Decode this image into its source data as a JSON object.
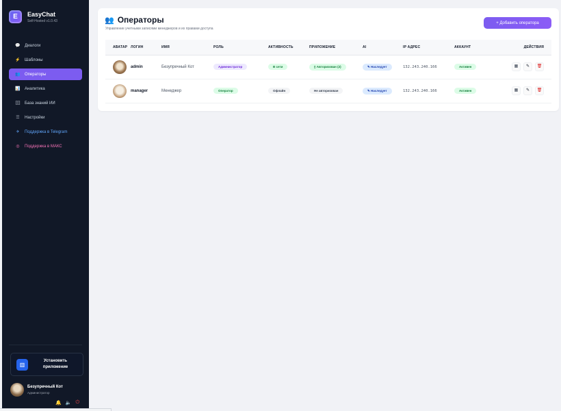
{
  "brand": {
    "logo_letter": "E",
    "name": "EasyChat",
    "version": "Self-Hosted v1.0.43"
  },
  "nav": [
    {
      "label": "Диалоги",
      "icon": "chat-icon",
      "glyph": "💬",
      "active": false
    },
    {
      "label": "Шаблоны",
      "icon": "bolt-icon",
      "glyph": "⚡",
      "active": false
    },
    {
      "label": "Операторы",
      "icon": "users-icon",
      "glyph": "👥",
      "active": true
    },
    {
      "label": "Аналитика",
      "icon": "chart-icon",
      "glyph": "📊",
      "active": false
    },
    {
      "label": "База знаний ИИ",
      "icon": "database-icon",
      "glyph": "🗄",
      "active": false
    },
    {
      "label": "Настройки",
      "icon": "sliders-icon",
      "glyph": "☰",
      "active": false
    },
    {
      "label": "Поддержка в Telegram",
      "icon": "telegram-icon",
      "glyph": "✈",
      "active": false
    },
    {
      "label": "Поддержка в МАКС",
      "icon": "max-icon",
      "glyph": "◎",
      "active": false
    }
  ],
  "install": {
    "label": "Установить приложение",
    "icon": "app-icon"
  },
  "user": {
    "name": "Безупречный Кот",
    "role": "Администратор"
  },
  "header": {
    "title": "Операторы",
    "subtitle": "Управление учетными записями менеджеров и их правами доступа",
    "add_button": "+ Добавить оператора"
  },
  "table": {
    "columns": [
      "АВАТАР",
      "ЛОГИН",
      "ИМЯ",
      "РОЛЬ",
      "АКТИВНОСТЬ",
      "ПРИЛОЖЕНИЕ",
      "AI",
      "IP АДРЕС",
      "АККАУНТ",
      "ДЕЙСТВИЯ"
    ],
    "rows": [
      {
        "login": "admin",
        "name": "Безупречный Кот",
        "role": "Администратор",
        "activity": "В сети",
        "app": "▯ Авторизован (2)",
        "ai": "✎ Наследует",
        "ip": "132.243.240.166",
        "account": "Активен"
      },
      {
        "login": "manager",
        "name": "Менеджер",
        "role": "Оператор",
        "activity": "Офлайн",
        "app": "Не авторизован",
        "ai": "✎ Наследует",
        "ip": "132.243.240.166",
        "account": "Активен"
      }
    ]
  },
  "colors": {
    "accent": "#7c5cf0",
    "sidebar": "#111827",
    "danger": "#dc2626"
  }
}
